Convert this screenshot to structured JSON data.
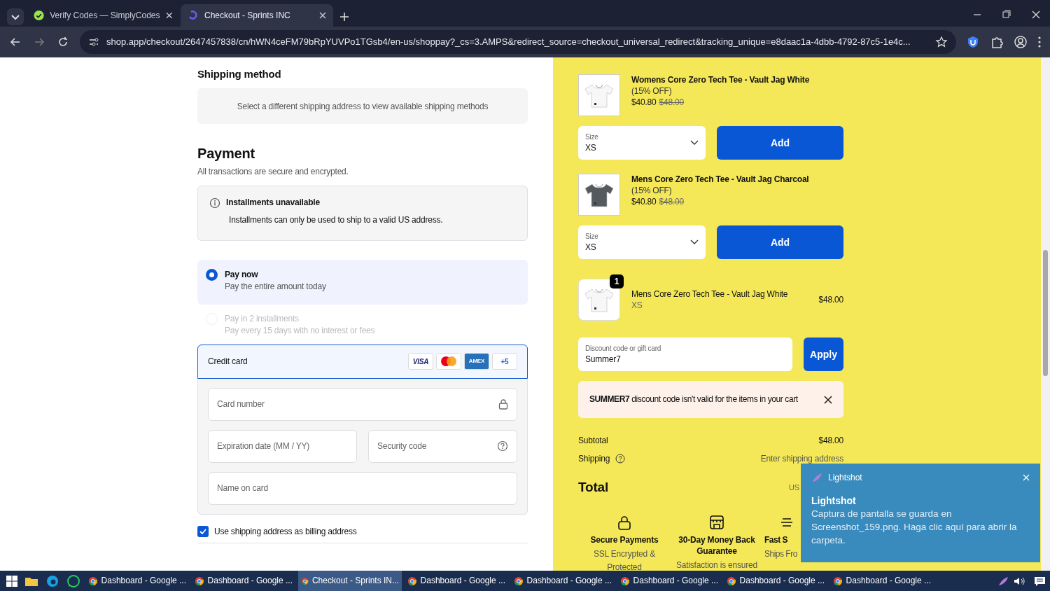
{
  "browser": {
    "tabs": [
      {
        "title": "Verify Codes — SimplyCodes",
        "selected": false,
        "kind": "simplycodes"
      },
      {
        "title": "Checkout - Sprints INC",
        "selected": true,
        "kind": "shop"
      }
    ],
    "url": "shop.app/checkout/2647457838/cn/hWN4ceFM79bRpYUVPo1TGsb4/en-us/shoppay?_cs=3.AMPS&redirect_source=checkout_universal_redirect&tracking_unique=e8daac1a-4dbb-4792-87c5-1e4c..."
  },
  "shipping": {
    "heading": "Shipping method",
    "notice": "Select a different shipping address to view available shipping methods"
  },
  "payment": {
    "heading": "Payment",
    "subtitle": "All transactions are secure and encrypted.",
    "installments_notice": {
      "title": "Installments unavailable",
      "text": "Installments can only be used to ship to a valid US address."
    },
    "options": [
      {
        "title": "Pay now",
        "description": "Pay the entire amount today",
        "selected": true,
        "disabled": false
      },
      {
        "title": "Pay in 2 installments",
        "description": "Pay every 15 days with no interest or fees",
        "selected": false,
        "disabled": true
      }
    ],
    "method": {
      "label": "Credit card",
      "brands": [
        {
          "kind": "visa",
          "label": "VISA"
        },
        {
          "kind": "mastercard"
        },
        {
          "kind": "amex",
          "label": "AMEX"
        },
        {
          "kind": "more",
          "label": "+5"
        }
      ]
    },
    "fields": {
      "card_number": {
        "placeholder": "Card number"
      },
      "expiry": {
        "placeholder": "Expiration date (MM / YY)"
      },
      "security": {
        "placeholder": "Security code"
      },
      "name": {
        "placeholder": "Name on card"
      }
    },
    "billing_same": {
      "label": "Use shipping address as billing address",
      "checked": true
    }
  },
  "upsells": [
    {
      "name": "Womens Core Zero Tech Tee - Vault Jag White",
      "discount": "(15% OFF)",
      "price": "$40.80",
      "old_price": "$48.00",
      "size_label": "Size",
      "size": "XS",
      "button": "Add"
    },
    {
      "name": "Mens Core Zero Tech Tee - Vault Jag Charcoal",
      "discount": "(15% OFF)",
      "price": "$40.80",
      "old_price": "$48.00",
      "size_label": "Size",
      "size": "XS",
      "button": "Add"
    }
  ],
  "cart": [
    {
      "quantity": "1",
      "name": "Mens Core Zero Tech Tee - Vault Jag White",
      "variant": "XS",
      "price": "$48.00"
    }
  ],
  "discount": {
    "label": "Discount code or gift card",
    "value": "Summer7",
    "button": "Apply",
    "error": "**SUMMER7** discount code isn't valid for the items in your cart"
  },
  "summary": {
    "subtotal_label": "Subtotal",
    "subtotal": "$48.00",
    "shipping_label": "Shipping",
    "shipping": "Enter shipping address",
    "total_label": "Total",
    "currency": "US"
  },
  "badges": [
    {
      "kind": "lock",
      "title": "Secure Payments",
      "text": "SSL Encrypted & Protected"
    },
    {
      "kind": "store",
      "title": "30-Day Money Back Guarantee",
      "text": "Satisfaction is ensured"
    },
    {
      "kind": "truck",
      "title": "Fast S",
      "text": "Ships Fro"
    }
  ],
  "toast": {
    "app": "Lightshot",
    "title": "Lightshot",
    "text": "Captura de pantalla se guarda en Screenshot_159.png. Haga clic aquí para abrir la carpeta."
  },
  "taskbar": [
    {
      "label": "Dashboard - Google ...",
      "selected": false
    },
    {
      "label": "Dashboard - Google ...",
      "selected": false
    },
    {
      "label": "Checkout - Sprints IN...",
      "selected": true
    },
    {
      "label": "Dashboard - Google ...",
      "selected": false
    },
    {
      "label": "Dashboard - Google ...",
      "selected": false
    },
    {
      "label": "Dashboard - Google ...",
      "selected": false
    },
    {
      "label": "Dashboard - Google ...",
      "selected": false
    },
    {
      "label": "Dashboard - Google ...",
      "selected": false
    }
  ]
}
